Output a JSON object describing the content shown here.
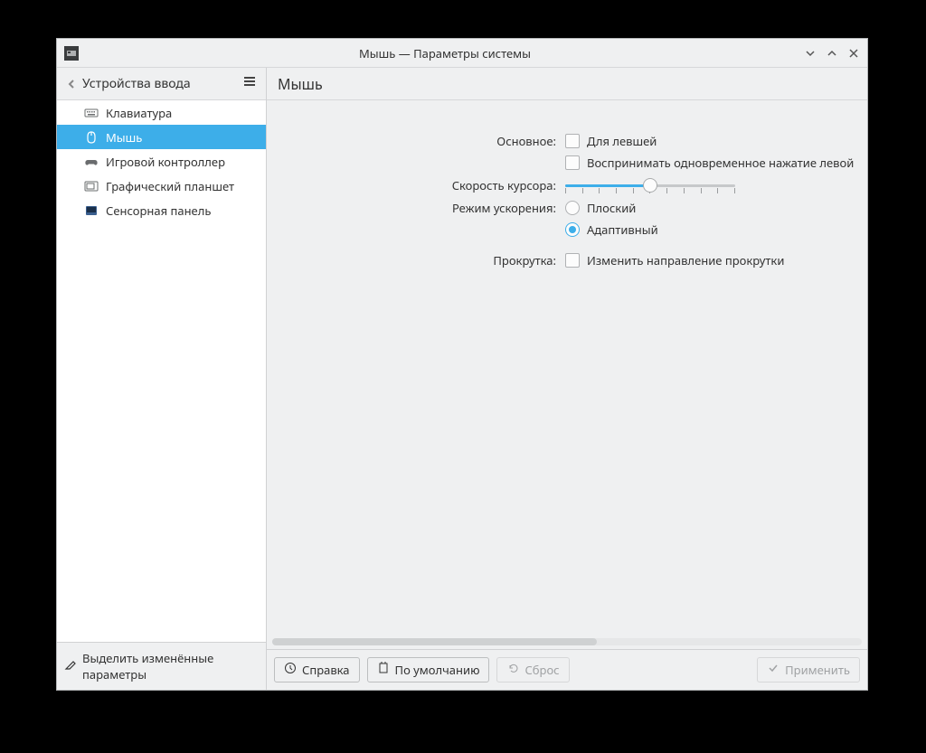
{
  "window": {
    "title": "Мышь — Параметры системы"
  },
  "sidebar": {
    "header": "Устройства ввода",
    "items": [
      {
        "label": "Клавиатура",
        "icon": "keyboard"
      },
      {
        "label": "Мышь",
        "icon": "mouse",
        "selected": true
      },
      {
        "label": "Игровой контроллер",
        "icon": "gamepad"
      },
      {
        "label": "Графический планшет",
        "icon": "tablet"
      },
      {
        "label": "Сенсорная панель",
        "icon": "touchpad"
      }
    ],
    "footer_label": "Выделить изменённые параметры"
  },
  "page": {
    "title": "Мышь",
    "labels": {
      "general": "Основное:",
      "speed": "Скорость курсора:",
      "accel_mode": "Режим ускорения:",
      "scrolling": "Прокрутка:"
    },
    "options": {
      "left_handed": "Для левшей",
      "both_click": "Воспринимать одновременное нажатие левой",
      "flat": "Плоский",
      "adaptive": "Адаптивный",
      "reverse_scroll": "Изменить направление прокрутки"
    },
    "values": {
      "left_handed_checked": false,
      "both_click_checked": false,
      "speed_percent": 50,
      "accel_mode": "adaptive",
      "reverse_scroll_checked": false
    }
  },
  "buttons": {
    "help": "Справка",
    "defaults": "По умолчанию",
    "reset": "Сброс",
    "apply": "Применить"
  }
}
